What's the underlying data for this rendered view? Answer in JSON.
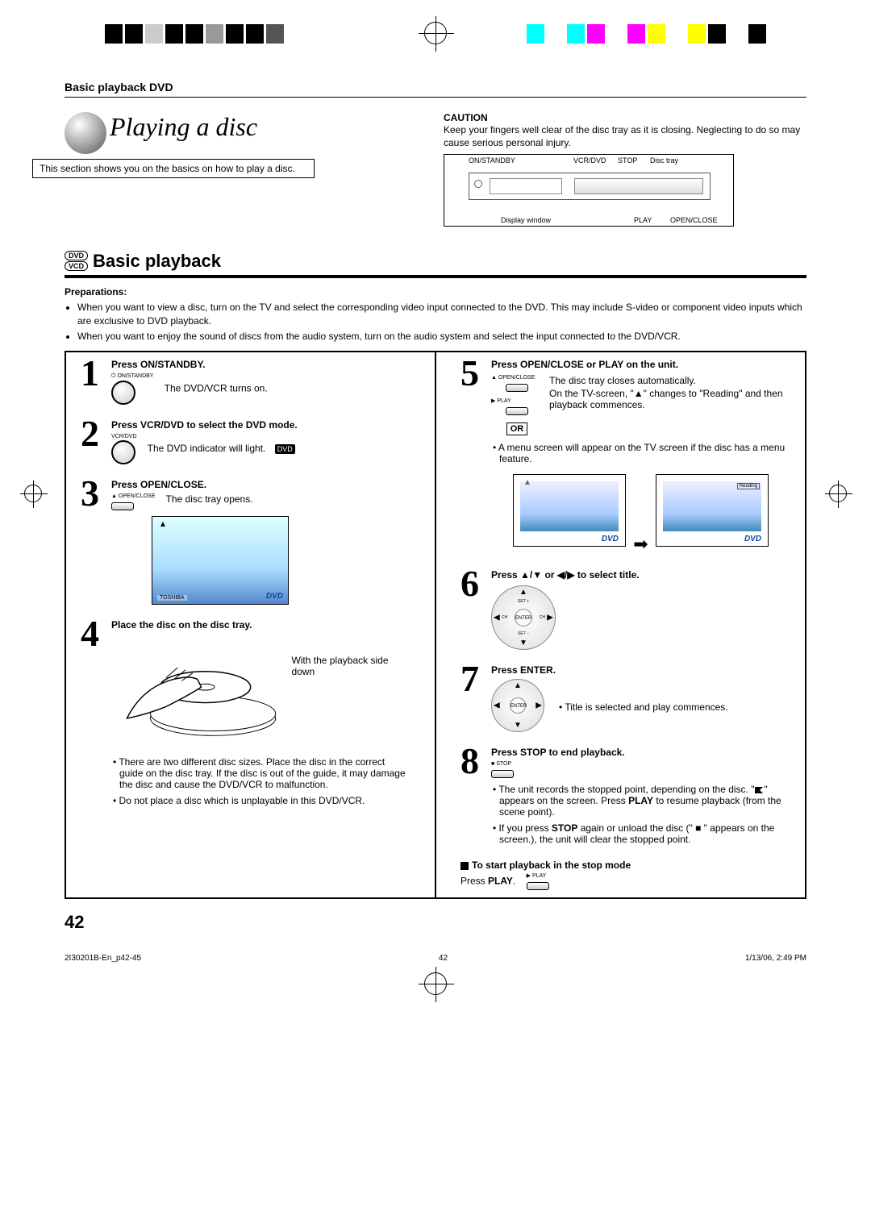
{
  "header": "Basic playback DVD",
  "title": "Playing a disc",
  "subtitle_box": "This section shows you on the basics on how to play a disc.",
  "caution": {
    "title": "CAUTION",
    "text": "Keep your fingers well clear of the disc tray as it is closing. Neglecting to do so may cause serious personal injury."
  },
  "diagram_labels": {
    "on_standby": "ON/STANDBY",
    "vcr_dvd": "VCR/DVD",
    "stop": "STOP",
    "disc_tray": "Disc tray",
    "display_window": "Display window",
    "play": "PLAY",
    "open_close": "OPEN/CLOSE"
  },
  "section": {
    "badge_top": "DVD",
    "badge_bottom": "VCD",
    "title": "Basic playback"
  },
  "preparations": {
    "title": "Preparations:",
    "items": [
      "When you want to view a disc, turn on the TV and select the corresponding video input connected to the DVD. This may include S-video or component video inputs which are exclusive to DVD playback.",
      "When you want to enjoy the sound of discs from the audio system, turn on the audio system and select the input connected to the DVD/VCR."
    ]
  },
  "steps": {
    "s1": {
      "title": "Press ON/STANDBY.",
      "text": "The DVD/VCR turns on.",
      "btn_label": "ON/STANDBY"
    },
    "s2": {
      "title": "Press VCR/DVD to select the DVD mode.",
      "text": "The DVD indicator will light.",
      "btn_label": "VCR/DVD",
      "indicator": "DVD"
    },
    "s3": {
      "title": "Press OPEN/CLOSE.",
      "text": "The disc tray opens.",
      "btn_label": "OPEN/CLOSE",
      "screen_logo": "DVD",
      "screen_brand": "TOSHIBA"
    },
    "s4": {
      "title": "Place the disc on the disc tray.",
      "text": "With the playback side down",
      "note1": "There are two different disc sizes. Place the disc in the correct guide on the disc tray. If the disc is out of the guide, it may damage the disc and cause the DVD/VCR to malfunction.",
      "note2": "Do not place a disc which is unplayable in this DVD/VCR."
    },
    "s5": {
      "title": "Press OPEN/CLOSE or PLAY on the unit.",
      "text1": "The disc tray closes automatically.",
      "text2": "On the TV-screen, \"▲\" changes to \"Reading\" and then playback commences.",
      "or": "OR",
      "btn1_label": "OPEN/CLOSE",
      "btn2_label": "PLAY",
      "note1": "A menu screen will appear on the TV screen if the disc has a menu feature.",
      "reading": "Reading",
      "screen_logo": "DVD"
    },
    "s6": {
      "title": "Press ▲/▼ or ◀/▶ to select title.",
      "pad_center": "ENTER",
      "pad_set_plus": "SET +",
      "pad_set_minus": "SET –",
      "pad_ch_up": "CH",
      "pad_ch_dn": "CH"
    },
    "s7": {
      "title": "Press ENTER.",
      "text": "Title is selected and play commences.",
      "pad_center": "ENTER"
    },
    "s8": {
      "title": "Press STOP to end playback.",
      "btn_label": "STOP",
      "note1a": "The unit records the stopped point, depending on the disc. \"",
      "note1b": "\" appears on the screen. Press ",
      "note1c": "PLAY",
      "note1d": " to resume playback (from the scene point).",
      "note2a": "If you press ",
      "note2b": "STOP",
      "note2c": " again or unload the disc (\" ■ \" appears on the screen.), the unit will clear the stopped point."
    }
  },
  "restart": {
    "title": "To start playback in the stop mode",
    "text1": "Press ",
    "text2": "PLAY",
    "text3": ".",
    "btn_label": "PLAY"
  },
  "page_number": "42",
  "footer": {
    "left": "2I30201B-En_p42-45",
    "mid": "42",
    "right": "1/13/06, 2:49 PM"
  }
}
